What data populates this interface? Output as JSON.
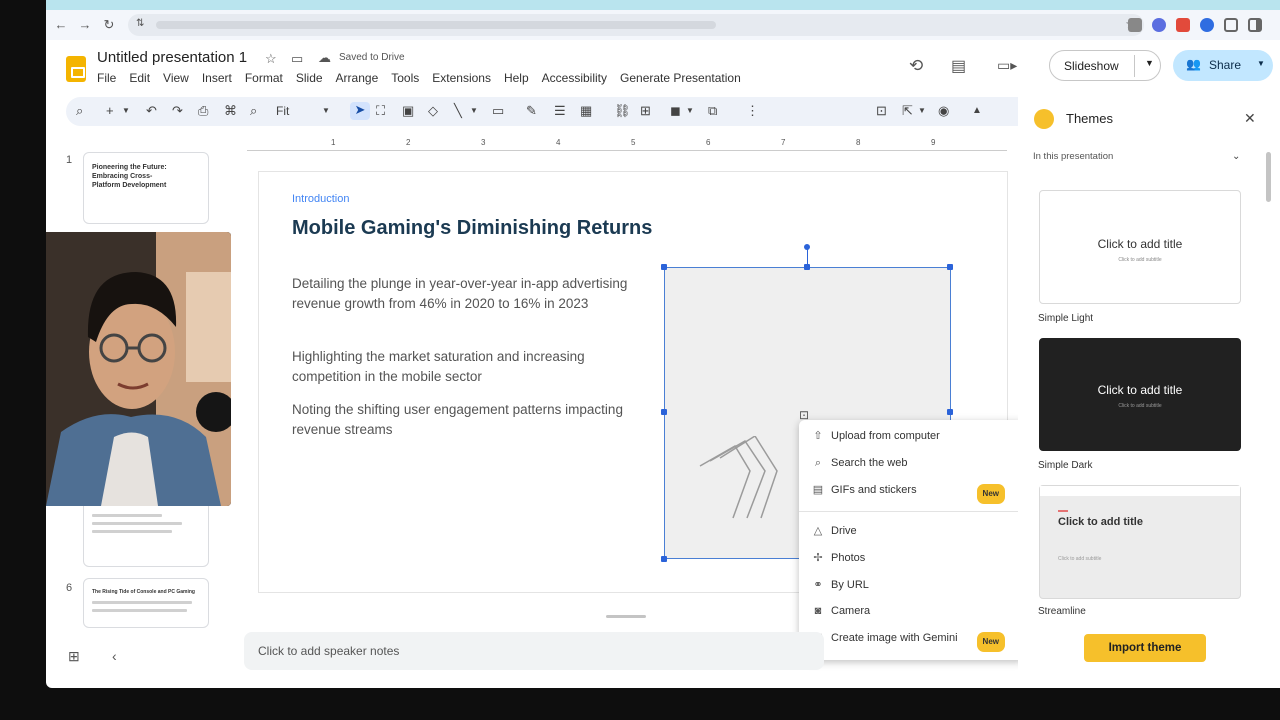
{
  "browser": {
    "nav": {
      "back": "←",
      "forward": "→",
      "reload": "↻"
    }
  },
  "header": {
    "title": "Untitled presentation 1",
    "saved": "Saved to Drive",
    "menus": [
      "File",
      "Edit",
      "View",
      "Insert",
      "Format",
      "Slide",
      "Arrange",
      "Tools",
      "Extensions",
      "Help",
      "Accessibility",
      "Generate Presentation"
    ],
    "slideshow_label": "Slideshow",
    "share_label": "Share"
  },
  "toolbar": {
    "zoom": "Fit"
  },
  "filmstrip": {
    "slides": [
      {
        "num": "1",
        "text": "Pioneering the Future: Embracing Cross-Platform Development"
      },
      {
        "num": "6",
        "text": "The Rising Tide of Console and PC Gaming"
      }
    ]
  },
  "ruler": {
    "ticks": [
      "1",
      "2",
      "3",
      "4",
      "5",
      "6",
      "7",
      "8",
      "9"
    ]
  },
  "slide": {
    "intro": "Introduction",
    "heading": "Mobile Gaming's Diminishing Returns",
    "bullets": [
      "Detailing the plunge in year-over-year in-app advertising revenue growth from 46% in 2020 to 16% in 2023",
      "Highlighting the market saturation and increasing competition in the mobile sector",
      "Noting the shifting user engagement patterns impacting revenue streams"
    ]
  },
  "image_menu": {
    "items": [
      {
        "label": "Upload from computer",
        "icon": "upload-icon"
      },
      {
        "label": "Search the web",
        "icon": "search-icon"
      },
      {
        "label": "GIFs and stickers",
        "icon": "gif-icon",
        "badge": "New"
      },
      {
        "label": "Drive",
        "icon": "drive-icon"
      },
      {
        "label": "Photos",
        "icon": "photos-icon"
      },
      {
        "label": "By URL",
        "icon": "link-icon"
      },
      {
        "label": "Camera",
        "icon": "camera-icon"
      },
      {
        "label": "Create image with Gemini",
        "icon": "gemini-image-icon",
        "badge": "New"
      }
    ]
  },
  "themes": {
    "title": "Themes",
    "filter": "In this presentation",
    "cards": [
      {
        "name": "Simple Light",
        "title": "Click to add title",
        "subtitle": "Click to add subtitle"
      },
      {
        "name": "Simple Dark",
        "title": "Click to add title",
        "subtitle": "Click to add subtitle"
      },
      {
        "name": "Streamline",
        "title": "Click to add title",
        "subtitle": "Click to add subtitle"
      }
    ],
    "import_label": "Import theme"
  },
  "notes": {
    "placeholder": "Click to add speaker notes"
  },
  "colors": {
    "accent": "#4285f4",
    "heading": "#1b3a52",
    "badge": "#f6c02b",
    "share_bg": "#c2e7ff"
  }
}
